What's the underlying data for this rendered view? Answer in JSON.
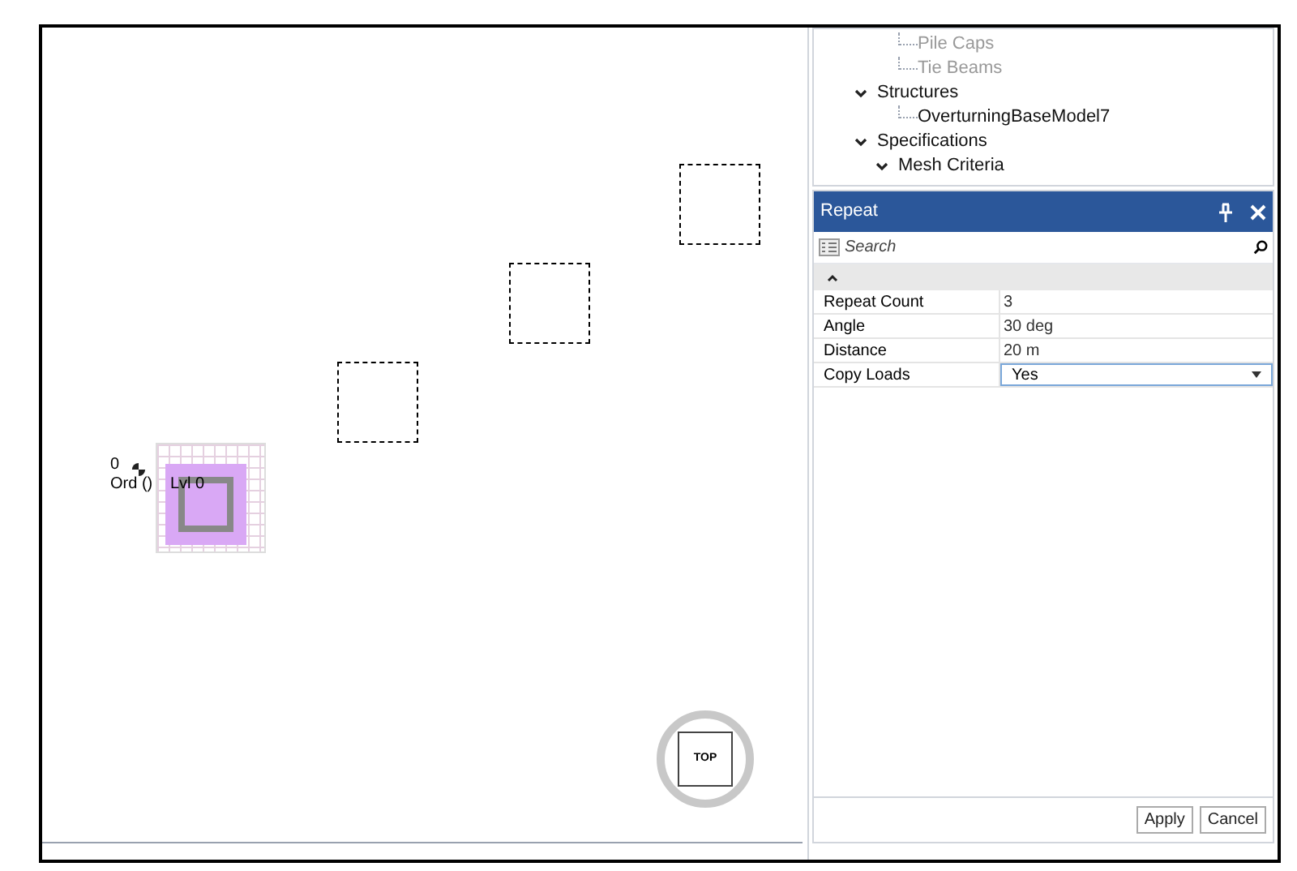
{
  "viewport": {
    "labels": [
      {
        "text": "0"
      },
      {
        "text": "Ord ()"
      },
      {
        "text": "Lvl 0"
      }
    ],
    "view_cube": {
      "label": "TOP"
    }
  },
  "tree": {
    "items": [
      {
        "label": "Pile Caps",
        "dimmed": true
      },
      {
        "label": "Tie Beams",
        "dimmed": true
      },
      {
        "label": "Structures",
        "dimmed": false,
        "expanded": true,
        "children": [
          {
            "label": "OverturningBaseModel7",
            "dimmed": false
          }
        ]
      },
      {
        "label": "Specifications",
        "dimmed": false,
        "expanded": true,
        "children": [
          {
            "label": "Mesh Criteria",
            "dimmed": false,
            "expanded": true
          }
        ]
      }
    ]
  },
  "panel": {
    "title": "Repeat",
    "search": {
      "placeholder": "Search"
    },
    "properties": [
      {
        "name": "Repeat Count",
        "value": "3",
        "kind": "text"
      },
      {
        "name": "Angle",
        "value": "30 deg",
        "kind": "text"
      },
      {
        "name": "Distance",
        "value": "20 m",
        "kind": "text"
      },
      {
        "name": "Copy Loads",
        "value": "Yes",
        "kind": "dropdown"
      }
    ],
    "buttons": [
      "Apply",
      "Cancel"
    ]
  }
}
